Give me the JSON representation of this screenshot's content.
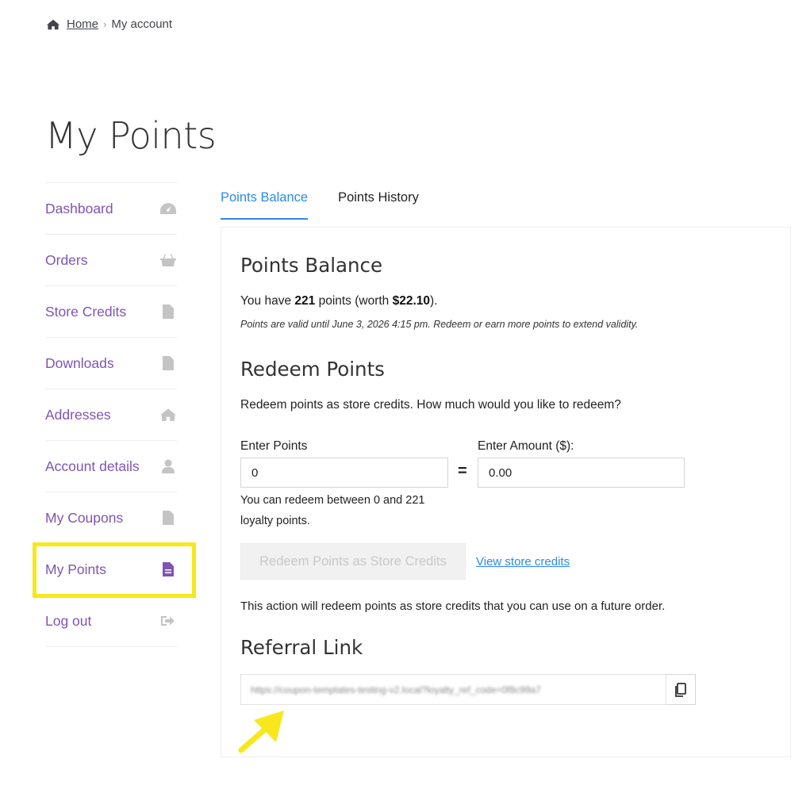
{
  "breadcrumb": {
    "home": "Home",
    "separator": "›",
    "current": "My account"
  },
  "page_title": "My Points",
  "sidebar": {
    "items": [
      {
        "label": "Dashboard",
        "icon": "dashboard-gauge-icon"
      },
      {
        "label": "Orders",
        "icon": "basket-icon"
      },
      {
        "label": "Store Credits",
        "icon": "file-icon"
      },
      {
        "label": "Downloads",
        "icon": "file-download-icon"
      },
      {
        "label": "Addresses",
        "icon": "home-icon"
      },
      {
        "label": "Account details",
        "icon": "user-icon"
      },
      {
        "label": "My Coupons",
        "icon": "file-icon"
      },
      {
        "label": "My Points",
        "icon": "file-icon",
        "active": true
      },
      {
        "label": "Log out",
        "icon": "sign-out-icon"
      }
    ]
  },
  "tabs": [
    {
      "label": "Points Balance",
      "active": true
    },
    {
      "label": "Points History",
      "active": false
    }
  ],
  "balance": {
    "heading": "Points Balance",
    "prefix": "You have ",
    "points": "221",
    "middle": " points (worth ",
    "worth": "$22.10",
    "suffix": ").",
    "validity": "Points are valid until June 3, 2026 4:15 pm. Redeem or earn more points to extend validity."
  },
  "redeem": {
    "heading": "Redeem Points",
    "description": "Redeem points as store credits. How much would you like to redeem?",
    "points_label": "Enter Points",
    "points_value": "0",
    "equals": "=",
    "amount_label": "Enter Amount ($):",
    "amount_value": "0.00",
    "range_note": "You can redeem between 0 and 221 loyalty points.",
    "button_label": "Redeem Points as Store Credits",
    "view_link": "View store credits",
    "action_note": "This action will redeem points as store credits that you can use on a future order."
  },
  "referral": {
    "heading": "Referral Link",
    "link": "https://coupon-templates-testing-v2.local?loyalty_ref_code=0f8c99a7",
    "copy_icon": "copy-icon"
  },
  "colors": {
    "accent_purple": "#7f54b3",
    "link_blue": "#2c8ae8",
    "highlight_yellow": "#f8e71c"
  }
}
